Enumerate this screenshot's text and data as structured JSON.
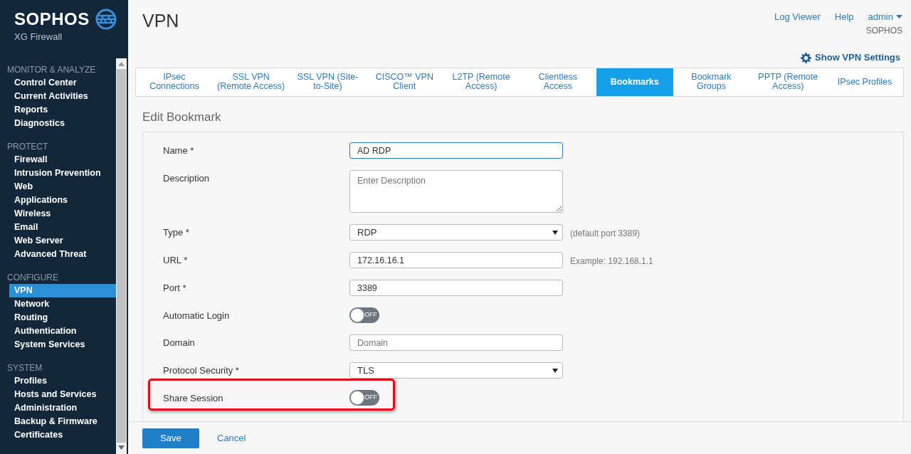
{
  "brand": {
    "name": "SOPHOS",
    "product": "XG Firewall"
  },
  "sidebar": {
    "sections": [
      {
        "title": "MONITOR & ANALYZE",
        "items": [
          {
            "label": "Control Center",
            "selected": false
          },
          {
            "label": "Current Activities",
            "selected": false
          },
          {
            "label": "Reports",
            "selected": false
          },
          {
            "label": "Diagnostics",
            "selected": false
          }
        ]
      },
      {
        "title": "PROTECT",
        "items": [
          {
            "label": "Firewall",
            "selected": false
          },
          {
            "label": "Intrusion Prevention",
            "selected": false
          },
          {
            "label": "Web",
            "selected": false
          },
          {
            "label": "Applications",
            "selected": false
          },
          {
            "label": "Wireless",
            "selected": false
          },
          {
            "label": "Email",
            "selected": false
          },
          {
            "label": "Web Server",
            "selected": false
          },
          {
            "label": "Advanced Threat",
            "selected": false
          }
        ]
      },
      {
        "title": "CONFIGURE",
        "items": [
          {
            "label": "VPN",
            "selected": true
          },
          {
            "label": "Network",
            "selected": false
          },
          {
            "label": "Routing",
            "selected": false
          },
          {
            "label": "Authentication",
            "selected": false
          },
          {
            "label": "System Services",
            "selected": false
          }
        ]
      },
      {
        "title": "SYSTEM",
        "items": [
          {
            "label": "Profiles",
            "selected": false
          },
          {
            "label": "Hosts and Services",
            "selected": false
          },
          {
            "label": "Administration",
            "selected": false
          },
          {
            "label": "Backup & Firmware",
            "selected": false
          },
          {
            "label": "Certificates",
            "selected": false
          }
        ]
      }
    ]
  },
  "header": {
    "title": "VPN",
    "links": [
      "Log Viewer",
      "Help"
    ],
    "user": {
      "name": "admin",
      "org": "SOPHOS"
    }
  },
  "settings_link": "Show VPN Settings",
  "tabs": [
    {
      "label": "IPsec Connections",
      "selected": false
    },
    {
      "label": "SSL VPN (Remote Access)",
      "selected": false
    },
    {
      "label": "SSL VPN (Site-to-Site)",
      "selected": false
    },
    {
      "label": "CISCO™ VPN Client",
      "selected": false
    },
    {
      "label": "L2TP (Remote Access)",
      "selected": false
    },
    {
      "label": "Clientless Access",
      "selected": false
    },
    {
      "label": "Bookmarks",
      "selected": true
    },
    {
      "label": "Bookmark Groups",
      "selected": false
    },
    {
      "label": "PPTP (Remote Access)",
      "selected": false
    },
    {
      "label": "IPsec Profiles",
      "selected": false
    }
  ],
  "form": {
    "title": "Edit Bookmark",
    "fields": [
      {
        "kind": "text",
        "label": "Name *",
        "value": "AD RDP",
        "focused": true,
        "highlighted": false
      },
      {
        "kind": "textarea",
        "label": "Description",
        "placeholder": "Enter Description",
        "focused": false,
        "highlighted": false
      },
      {
        "kind": "select",
        "label": "Type *",
        "value": "RDP",
        "hint": "(default port 3389)",
        "focused": false,
        "highlighted": false
      },
      {
        "kind": "text",
        "label": "URL *",
        "value": "172.16.16.1",
        "hint": "Example: 192.168.1.1",
        "focused": false,
        "highlighted": false
      },
      {
        "kind": "text",
        "label": "Port *",
        "value": "3389",
        "focused": false,
        "highlighted": false
      },
      {
        "kind": "toggle",
        "label": "Automatic Login",
        "on": false,
        "state_label": "OFF",
        "highlighted": false
      },
      {
        "kind": "text",
        "label": "Domain",
        "placeholder": "Domain",
        "focused": false,
        "highlighted": false
      },
      {
        "kind": "select",
        "label": "Protocol Security *",
        "value": "TLS",
        "focused": false,
        "highlighted": false
      },
      {
        "kind": "toggle",
        "label": "Share Session",
        "on": false,
        "state_label": "OFF",
        "highlighted": true
      }
    ]
  },
  "buttons": {
    "save": "Save",
    "cancel": "Cancel"
  }
}
